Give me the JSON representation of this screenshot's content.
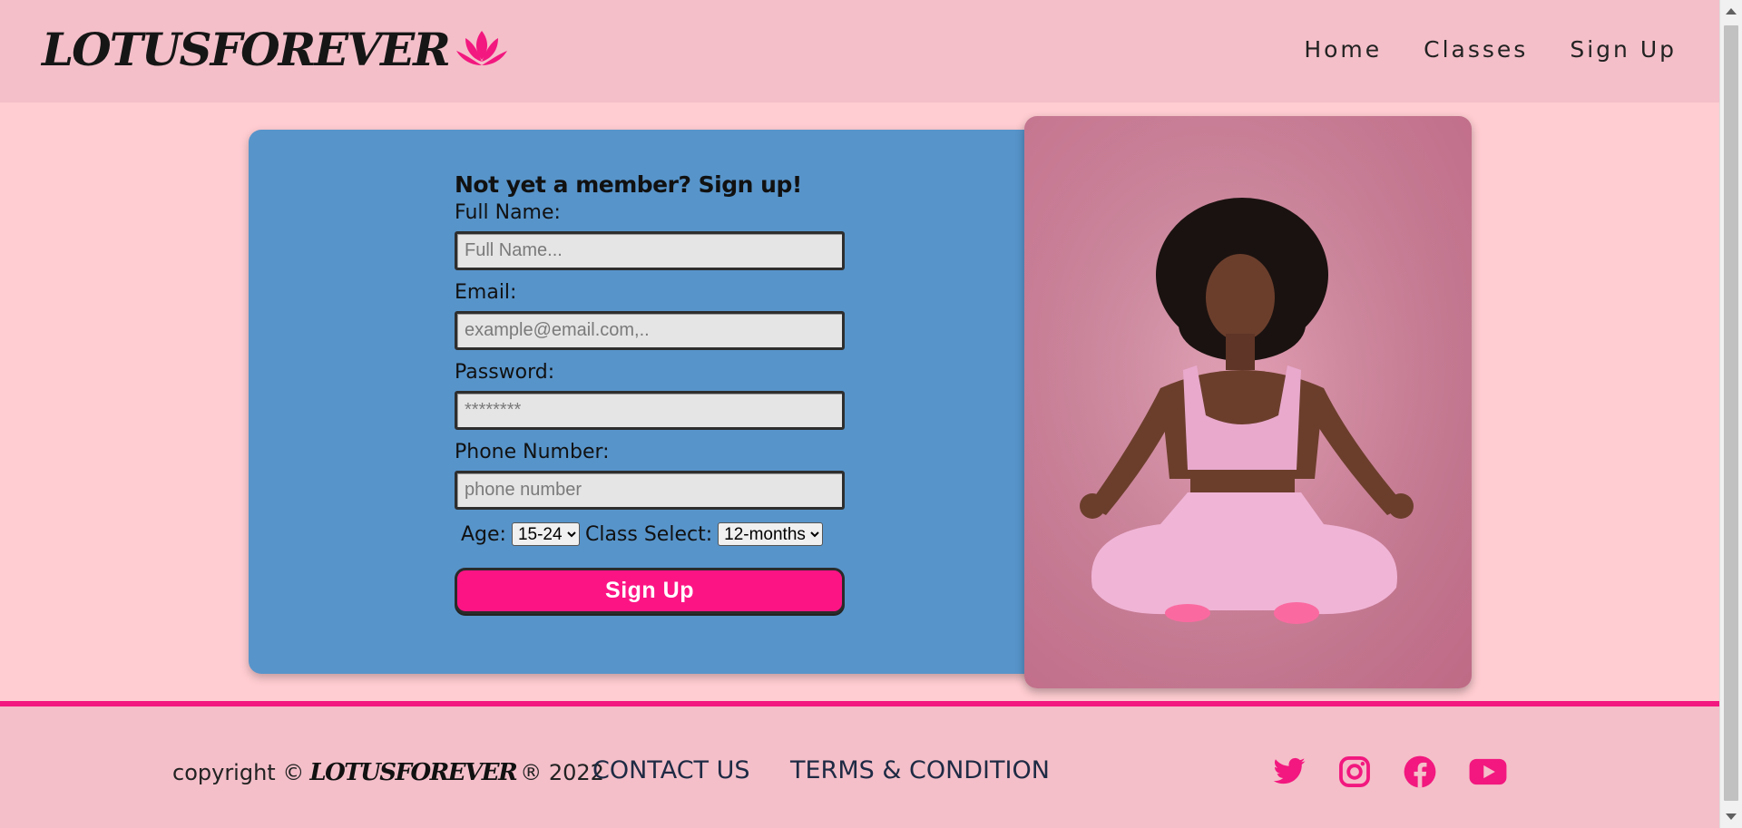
{
  "brand": {
    "name": "LOTUSFOREVER",
    "accent": "#fc1485"
  },
  "nav": {
    "items": [
      "Home",
      "Classes",
      "Sign Up"
    ]
  },
  "form": {
    "title": "Not yet a member? Sign up!",
    "fields": [
      {
        "label": "Full Name:",
        "placeholder": "Full Name..."
      },
      {
        "label": "Email:",
        "placeholder": "example@email.com,.."
      },
      {
        "label": "Password:",
        "placeholder": "********"
      },
      {
        "label": "Phone Number:",
        "placeholder": "phone number"
      }
    ],
    "age_label": "Age:",
    "age_value": "15-24",
    "class_label": "Class Select:",
    "class_value": "12-months",
    "submit_label": "Sign Up"
  },
  "footer": {
    "copyright_prefix": "copyright ©",
    "copyright_brand": "LOTUSFOREVER",
    "copyright_suffix": "® 2022",
    "links": [
      "CONTACT US",
      "TERMS & CONDITION"
    ],
    "socials": [
      "twitter-icon",
      "instagram-icon",
      "facebook-icon",
      "youtube-icon"
    ]
  },
  "colors": {
    "header_bg": "#f4bfc9",
    "page_bg": "#ffcdd2",
    "card_bg": "#5794ca",
    "button_bg": "#fc1485",
    "footer_line": "#f2187f"
  }
}
